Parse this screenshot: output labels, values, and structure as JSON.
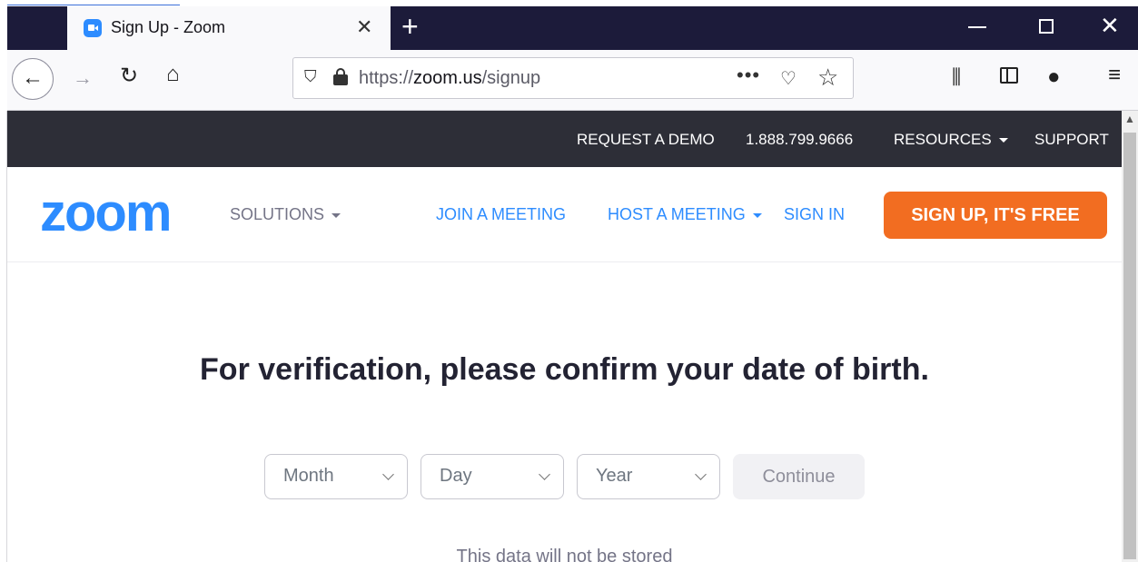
{
  "browser": {
    "tab_title": "Sign Up - Zoom",
    "tab_close": "✕",
    "new_tab": "+",
    "url_prefix": "https://",
    "url_host": "zoom.us",
    "url_path": "/signup",
    "page_actions": "•••"
  },
  "topbar": {
    "request_demo": "REQUEST A DEMO",
    "phone": "1.888.799.9666",
    "resources": "RESOURCES",
    "support": "SUPPORT"
  },
  "mainnav": {
    "logo": "zoom",
    "solutions": "SOLUTIONS",
    "join": "JOIN A MEETING",
    "host": "HOST A MEETING",
    "sign_in": "SIGN IN",
    "signup": "SIGN UP, IT'S FREE"
  },
  "verification": {
    "headline": "For verification, please confirm your date of birth.",
    "month": "Month",
    "day": "Day",
    "year": "Year",
    "continue": "Continue",
    "note": "This data will not be stored"
  },
  "colors": {
    "zoom_blue": "#2d8cff",
    "signup_orange": "#f26d21",
    "topbar_bg": "#2d2e37",
    "tabbar_bg": "#1c1b3a"
  }
}
